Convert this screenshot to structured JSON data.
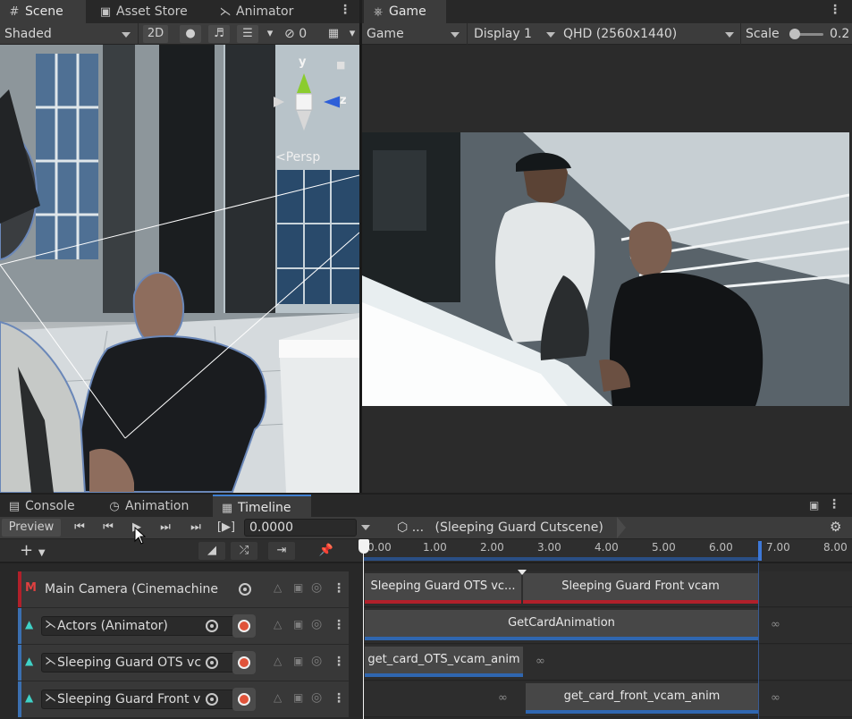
{
  "tabs_left": [
    {
      "label": "Scene",
      "icon": "grid-icon"
    },
    {
      "label": "Asset Store",
      "icon": "bag-icon"
    },
    {
      "label": "Animator",
      "icon": "animator-icon"
    }
  ],
  "tabs_right": [
    {
      "label": "Game",
      "icon": "gamepad-icon"
    }
  ],
  "scene_toolbar": {
    "shading": "Shaded",
    "mode_2d": "2D",
    "hidden_count": "0"
  },
  "scene_gizmo": {
    "y": "y",
    "z": "z",
    "persp": "Persp"
  },
  "game_toolbar": {
    "view": "Game",
    "display": "Display 1",
    "resolution": "QHD (2560x1440)",
    "scale_label": "Scale",
    "scale_value": "0.2",
    "scale_fraction": 0.05
  },
  "bottom_tabs": [
    {
      "label": "Console",
      "icon": "console-icon"
    },
    {
      "label": "Animation",
      "icon": "clock-icon"
    },
    {
      "label": "Timeline",
      "icon": "film-icon"
    }
  ],
  "timeline_toolbar": {
    "preview": "Preview",
    "time": "0.0000",
    "asset_ellipsis": "...",
    "asset": "(Sleeping Guard Cutscene)"
  },
  "ruler": [
    "0.00",
    "1.00",
    "2.00",
    "3.00",
    "4.00",
    "5.00",
    "6.00",
    "7.00",
    "8.00"
  ],
  "tracks": [
    {
      "name": "Main Camera (Cinemachine",
      "type": "cinemachine",
      "accent": "#b0202a"
    },
    {
      "name": "Actors (Animator)",
      "type": "animation",
      "accent": "#3b6fb0"
    },
    {
      "name": "Sleeping Guard OTS vc",
      "type": "animation",
      "accent": "#3b6fb0"
    },
    {
      "name": "Sleeping Guard Front v",
      "type": "animation",
      "accent": "#3b6fb0"
    }
  ],
  "clips": {
    "camera_ots": "Sleeping Guard OTS vc...",
    "camera_front": "Sleeping Guard Front vcam",
    "actors": "GetCardAnimation",
    "ots_anim": "get_card_OTS_vcam_anim",
    "front_anim": "get_card_front_vcam_anim"
  },
  "colors": {
    "panel": "#282828",
    "toolbar": "#3c3c3c",
    "camera_track": "#b0202a",
    "anim_track": "#3b6fb0",
    "record": "#e0533a"
  }
}
